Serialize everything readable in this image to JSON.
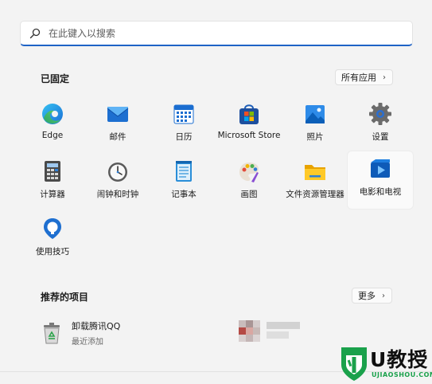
{
  "search": {
    "placeholder": "在此键入以搜索",
    "icon": "search-icon"
  },
  "pinned": {
    "title": "已固定",
    "all_apps_label": "所有应用",
    "apps": [
      {
        "label": "Edge",
        "icon": "edge-icon"
      },
      {
        "label": "邮件",
        "icon": "mail-icon"
      },
      {
        "label": "日历",
        "icon": "calendar-icon"
      },
      {
        "label": "Microsoft Store",
        "icon": "store-icon"
      },
      {
        "label": "照片",
        "icon": "photos-icon"
      },
      {
        "label": "设置",
        "icon": "settings-icon"
      },
      {
        "label": "计算器",
        "icon": "calculator-icon"
      },
      {
        "label": "闹钟和时钟",
        "icon": "clock-icon"
      },
      {
        "label": "记事本",
        "icon": "notepad-icon"
      },
      {
        "label": "画图",
        "icon": "paint-icon"
      },
      {
        "label": "文件资源管理器",
        "icon": "folder-icon"
      },
      {
        "label": "电影和电视",
        "icon": "movies-icon"
      },
      {
        "label": "使用技巧",
        "icon": "tips-icon"
      }
    ]
  },
  "recommended": {
    "title": "推荐的项目",
    "more_label": "更多",
    "items": [
      {
        "name": "卸载腾讯QQ",
        "subtitle": "最近添加",
        "icon": "recycle-bin-icon"
      }
    ]
  },
  "watermark": {
    "text": "U教授",
    "domain": "UJIAOSHOU.COM"
  },
  "colors": {
    "accent": "#1f63c6",
    "background": "#f3f3f3",
    "watermark_green": "#1aa14b"
  }
}
